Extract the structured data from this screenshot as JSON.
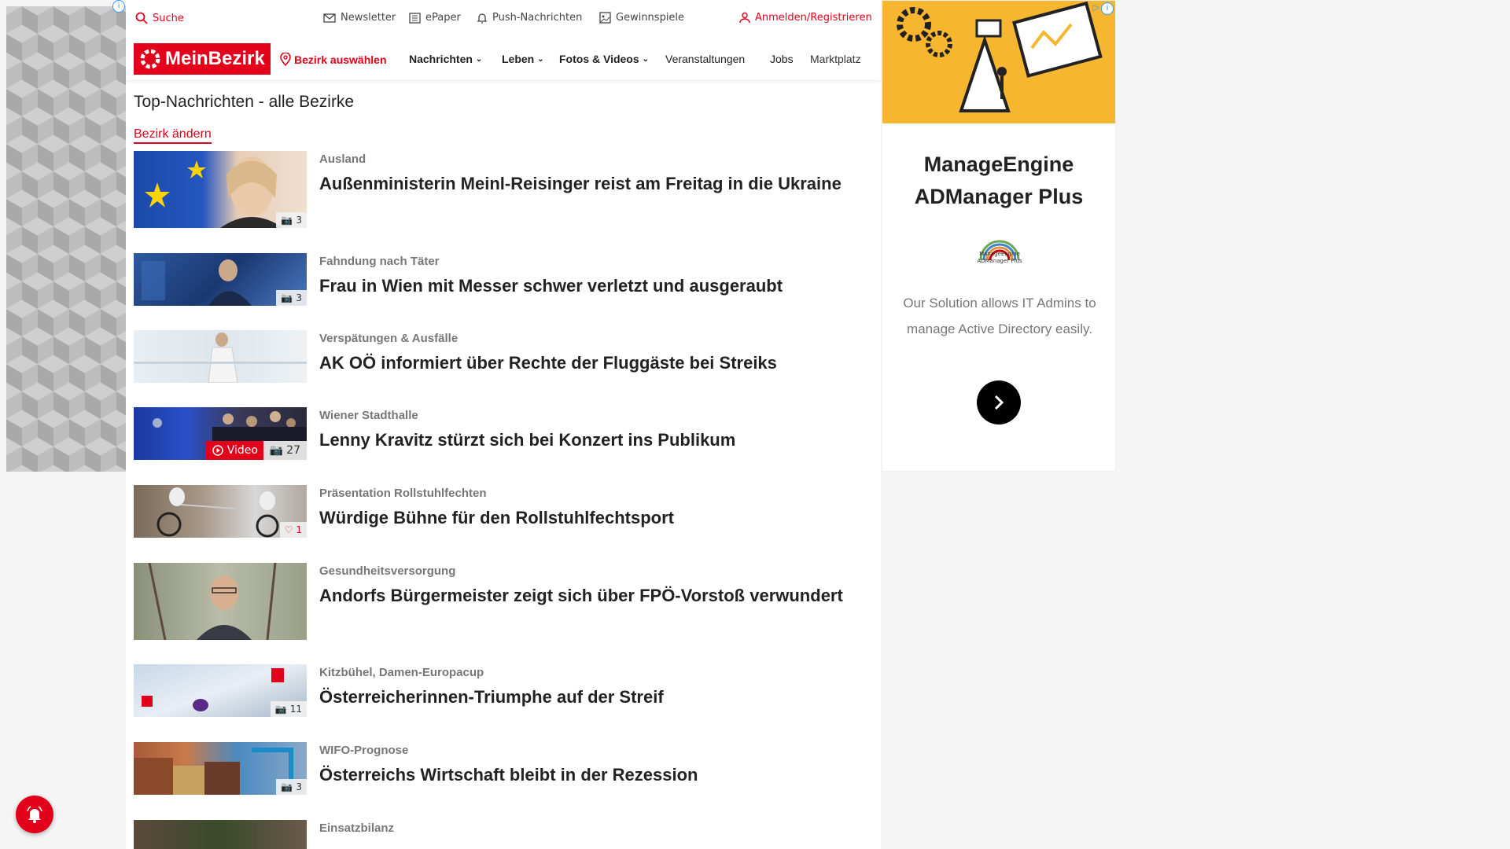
{
  "util": {
    "search": "Suche",
    "newsletter": "Newsletter",
    "epaper": "ePaper",
    "push": "Push-Nachrichten",
    "gewinnspiele": "Gewinnspiele",
    "login": "Anmelden/Registrieren"
  },
  "nav": {
    "logo": "MeinBezirk",
    "bezirk": "Bezirk auswählen",
    "items": [
      "Nachrichten",
      "Leben",
      "Fotos & Videos",
      "Veranstaltungen",
      "Jobs",
      "Marktplatz"
    ]
  },
  "page": {
    "heading": "Top-Nachrichten - alle Bezirke",
    "change": "Bezirk ändern"
  },
  "articles": [
    {
      "kicker": "Ausland",
      "title": "Außenministerin Meinl-Reisinger reist am Freitag in die Ukraine",
      "badge": "3",
      "badge_type": "photos"
    },
    {
      "kicker": "Fahndung nach Täter",
      "title": "Frau in Wien mit Messer schwer verletzt und ausgeraubt",
      "badge": "3",
      "badge_type": "photos"
    },
    {
      "kicker": "Verspätungen & Ausfälle",
      "title": "AK OÖ informiert über Rechte der Fluggäste bei Streiks",
      "badge": "",
      "badge_type": "none"
    },
    {
      "kicker": "Wiener Stadthalle",
      "title": "Lenny Kravitz stürzt sich bei Konzert ins Publikum",
      "badge": "27",
      "badge_type": "photos",
      "video": "Video"
    },
    {
      "kicker": "Präsentation Rollstuhlfechten",
      "title": "Würdige Bühne für den Rollstuhlfechtsport",
      "badge": "1",
      "badge_type": "likes"
    },
    {
      "kicker": "Gesundheitsversorgung",
      "title": "Andorfs Bürgermeister zeigt sich über FPÖ-Vorstoß verwundert",
      "badge": "",
      "badge_type": "none"
    },
    {
      "kicker": "Kitzbühel, Damen-Europacup",
      "title": "Österreicherinnen-Triumphe auf der Streif",
      "badge": "11",
      "badge_type": "photos"
    },
    {
      "kicker": "WIFO-Prognose",
      "title": "Österreichs Wirtschaft bleibt in der Rezession",
      "badge": "3",
      "badge_type": "photos"
    },
    {
      "kicker": "Einsatzbilanz",
      "title": "",
      "badge": "",
      "badge_type": "none"
    }
  ],
  "ad": {
    "title": "ManageEngine ADManager Plus",
    "logo_text": "ManageEngine ADManager Plus",
    "text": "Our Solution allows IT Admins to manage Active Directory easily."
  }
}
